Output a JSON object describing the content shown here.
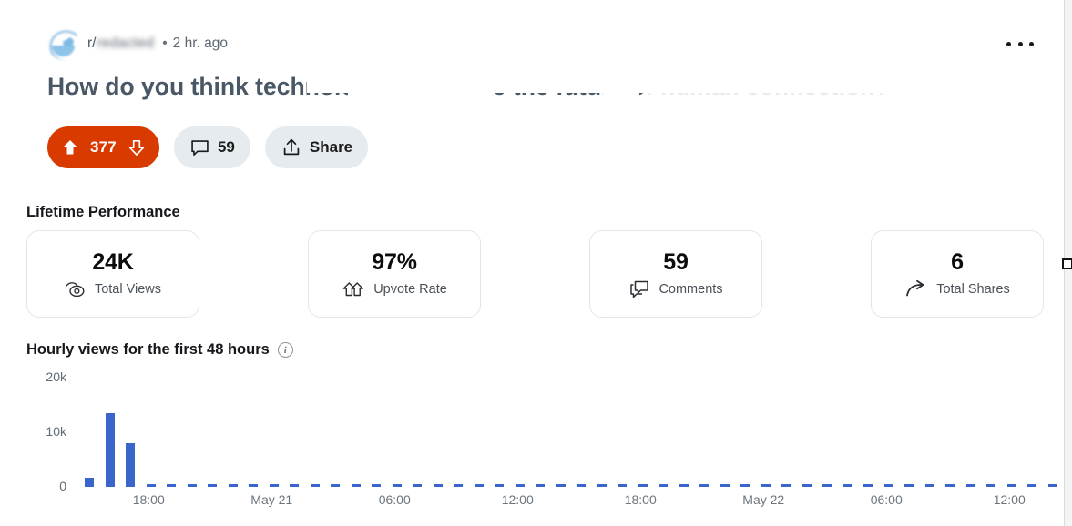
{
  "post": {
    "subreddit_prefix": "r/",
    "subreddit_name": "redacted",
    "separator": "•",
    "time_ago": "2 hr. ago",
    "title": "How do you think technology will shape the future of human connection?",
    "overflow_menu": "more-options"
  },
  "actions": {
    "upvote_icon": "upvote-arrow-icon",
    "score": "377",
    "downvote_icon": "downvote-arrow-icon",
    "comment_icon": "comment-bubble-icon",
    "comment_count": "59",
    "share_icon": "share-upload-icon",
    "share_label": "Share"
  },
  "lifetime": {
    "heading": "Lifetime Performance",
    "cards": [
      {
        "value": "24K",
        "label": "Total Views",
        "icon": "eye-icon"
      },
      {
        "value": "97%",
        "label": "Upvote Rate",
        "icon": "upvote-rate-icon"
      },
      {
        "value": "59",
        "label": "Comments",
        "icon": "comments-icon"
      },
      {
        "value": "6",
        "label": "Total Shares",
        "icon": "share-arrow-icon"
      }
    ]
  },
  "chart_section": {
    "heading": "Hourly views for the first 48 hours",
    "info_icon": "info-icon",
    "info_glyph": "i"
  },
  "chart_data": {
    "type": "bar",
    "title": "Hourly views for the first 48 hours",
    "xlabel": "",
    "ylabel": "",
    "ylim": [
      0,
      20000
    ],
    "ytick_labels": [
      "0",
      "10k",
      "20k"
    ],
    "ytick_values": [
      0,
      10000,
      20000
    ],
    "xtick_labels": [
      "18:00",
      "May 21",
      "06:00",
      "12:00",
      "18:00",
      "May 22",
      "06:00",
      "12:00"
    ],
    "grid": false,
    "bar_color": "#3a66cc",
    "categories": [
      "15:00",
      "16:00",
      "17:00",
      "18:00",
      "19:00",
      "20:00",
      "21:00",
      "22:00",
      "23:00",
      "00:00",
      "01:00",
      "02:00",
      "03:00",
      "04:00",
      "05:00",
      "06:00",
      "07:00",
      "08:00",
      "09:00",
      "10:00",
      "11:00",
      "12:00",
      "13:00",
      "14:00",
      "15:00",
      "16:00",
      "17:00",
      "18:00",
      "19:00",
      "20:00",
      "21:00",
      "22:00",
      "23:00",
      "00:00",
      "01:00",
      "02:00",
      "03:00",
      "04:00",
      "05:00",
      "06:00",
      "07:00",
      "08:00",
      "09:00",
      "10:00",
      "11:00",
      "12:00",
      "13:00",
      "14:00"
    ],
    "values": [
      1600,
      13500,
      8000,
      150,
      120,
      110,
      100,
      95,
      90,
      85,
      80,
      80,
      75,
      75,
      70,
      70,
      70,
      65,
      65,
      65,
      60,
      60,
      60,
      60,
      60,
      55,
      55,
      55,
      55,
      50,
      50,
      50,
      50,
      50,
      45,
      45,
      45,
      45,
      45,
      40,
      40,
      40,
      40,
      40,
      40,
      35,
      35,
      35
    ]
  },
  "right_rail": {
    "handle": "resize-handle"
  },
  "colors": {
    "upvote_pill": "#d93a00",
    "neutral_pill": "#e5ebee",
    "bar": "#3a66cc",
    "card_border": "#e3e6e8"
  }
}
